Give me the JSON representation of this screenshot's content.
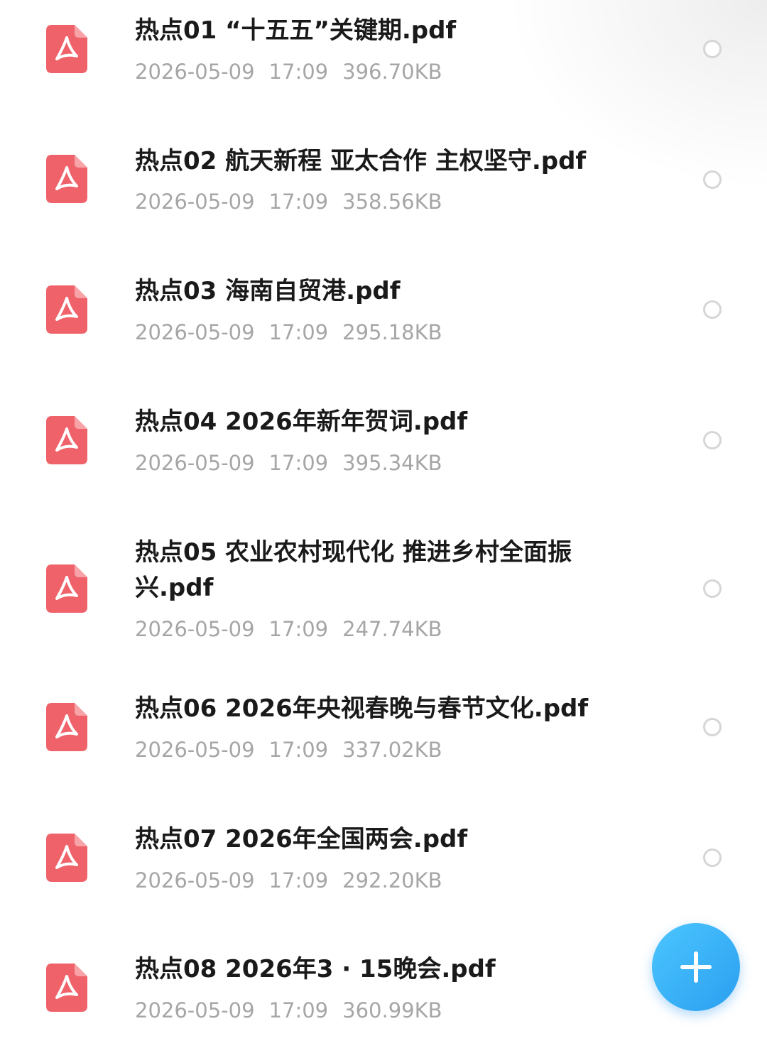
{
  "files": [
    {
      "name": "热点01 “十五五”关键期.pdf",
      "date": "2026-05-09",
      "time": "17:09",
      "size": "396.70KB",
      "icon": "pdf-icon"
    },
    {
      "name": "热点02 航天新程 亚太合作 主权坚守.pdf",
      "date": "2026-05-09",
      "time": "17:09",
      "size": "358.56KB",
      "icon": "pdf-icon"
    },
    {
      "name": "热点03 海南自贸港.pdf",
      "date": "2026-05-09",
      "time": "17:09",
      "size": "295.18KB",
      "icon": "pdf-icon"
    },
    {
      "name": "热点04 2026年新年贺词.pdf",
      "date": "2026-05-09",
      "time": "17:09",
      "size": "395.34KB",
      "icon": "pdf-icon"
    },
    {
      "name": "热点05 农业农村现代化 推进乡村全面振兴.pdf",
      "date": "2026-05-09",
      "time": "17:09",
      "size": "247.74KB",
      "icon": "pdf-icon"
    },
    {
      "name": "热点06 2026年央视春晚与春节文化.pdf",
      "date": "2026-05-09",
      "time": "17:09",
      "size": "337.02KB",
      "icon": "pdf-icon"
    },
    {
      "name": "热点07 2026年全国两会.pdf",
      "date": "2026-05-09",
      "time": "17:09",
      "size": "292.20KB",
      "icon": "pdf-icon"
    },
    {
      "name": "热点08 2026年3 · 15晚会.pdf",
      "date": "2026-05-09",
      "time": "17:09",
      "size": "360.99KB",
      "icon": "pdf-icon"
    }
  ],
  "colors": {
    "icon": "#f0626a",
    "fab": "#2a9ff0"
  },
  "fab": {
    "icon": "plus-icon"
  }
}
